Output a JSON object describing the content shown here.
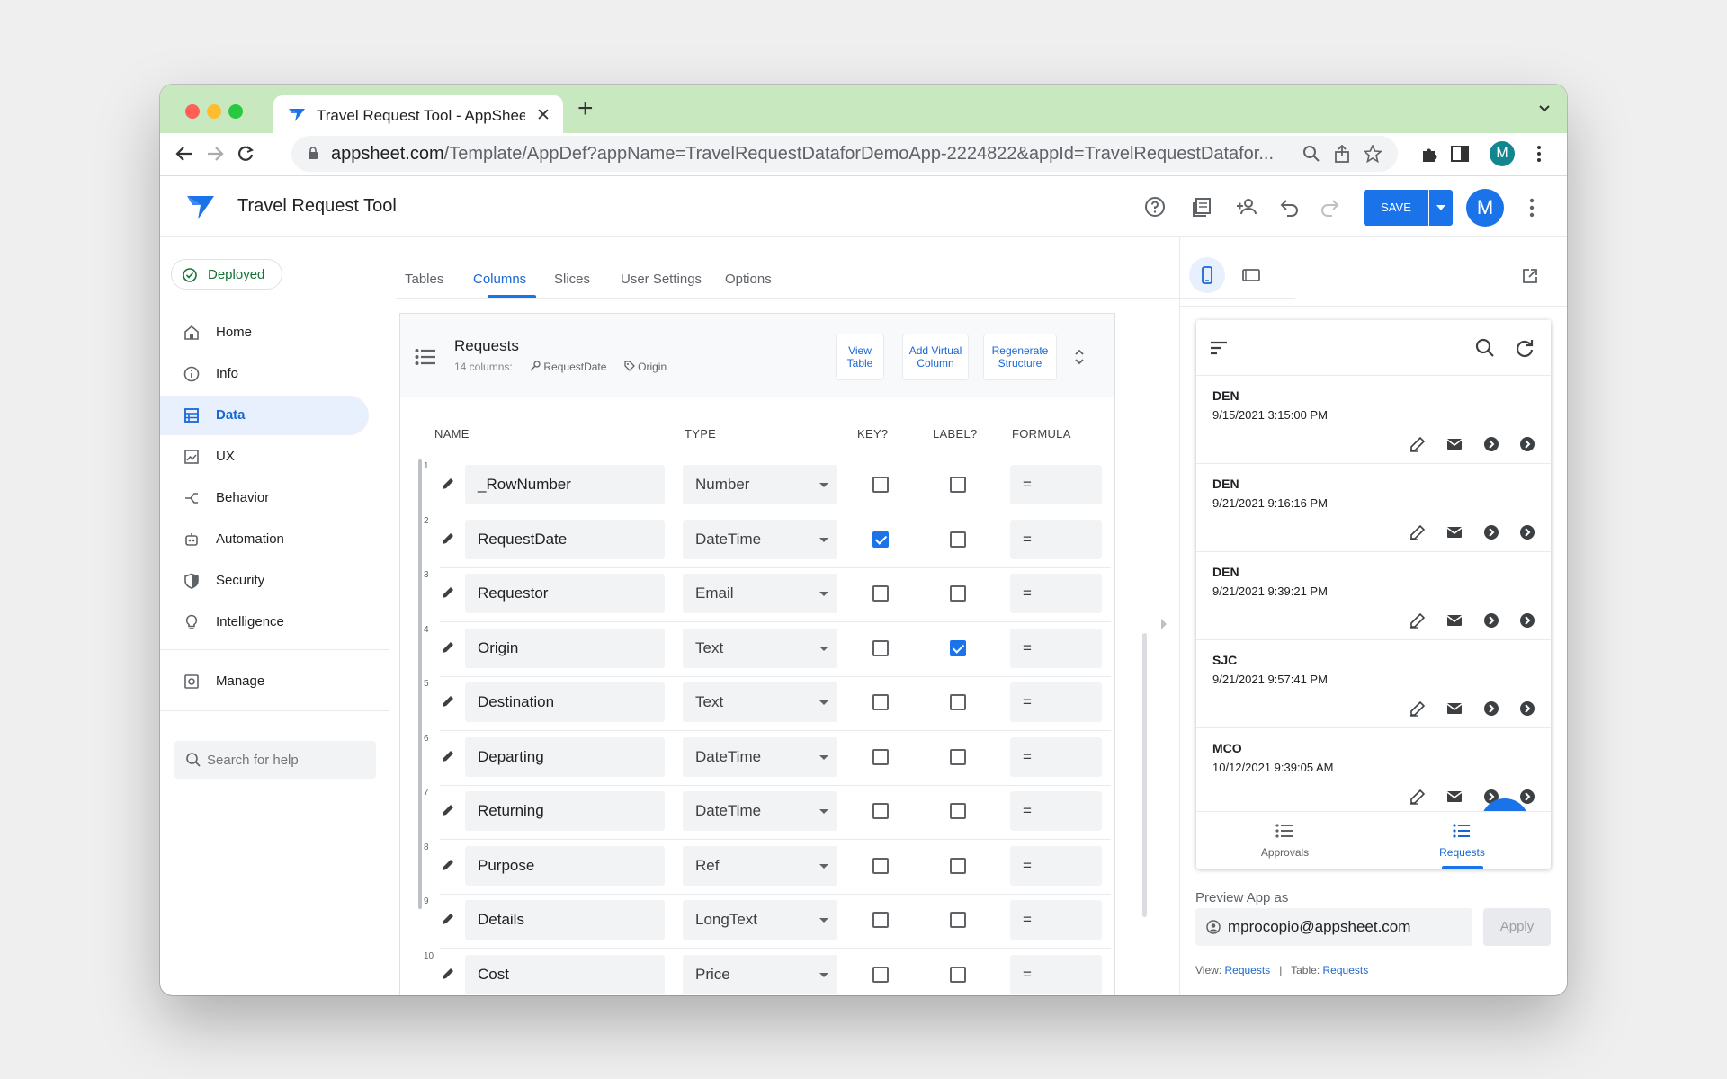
{
  "browser": {
    "tab_title": "Travel Request Tool - AppSheet",
    "url_host": "appsheet.com",
    "url_path": "/Template/AppDef?appName=TravelRequestDataforDemoApp-2224822&appId=TravelRequestDatafor...",
    "profile_initial": "M"
  },
  "app": {
    "title": "Travel Request Tool",
    "save_label": "SAVE",
    "avatar_initial": "M",
    "status": "Deployed"
  },
  "sidebar": {
    "items": [
      {
        "label": "Home",
        "icon": "home-icon"
      },
      {
        "label": "Info",
        "icon": "info-icon"
      },
      {
        "label": "Data",
        "icon": "data-icon",
        "active": true
      },
      {
        "label": "UX",
        "icon": "ux-icon"
      },
      {
        "label": "Behavior",
        "icon": "behavior-icon"
      },
      {
        "label": "Automation",
        "icon": "automation-icon"
      },
      {
        "label": "Security",
        "icon": "shield-icon"
      },
      {
        "label": "Intelligence",
        "icon": "lightbulb-icon"
      },
      {
        "label": "Manage",
        "icon": "manage-icon"
      }
    ],
    "search_placeholder": "Search for help"
  },
  "tabs": [
    "Tables",
    "Columns",
    "Slices",
    "User Settings",
    "Options"
  ],
  "active_tab": "Columns",
  "table": {
    "name": "Requests",
    "columns_count": "14 columns:",
    "key_column": "RequestDate",
    "label_column": "Origin",
    "buttons": {
      "view_table": "View Table",
      "add_virtual": "Add Virtual Column",
      "regenerate": "Regenerate Structure"
    },
    "headers": {
      "name": "NAME",
      "type": "TYPE",
      "key": "KEY?",
      "label": "LABEL?",
      "formula": "FORMULA"
    },
    "rows": [
      {
        "num": "1",
        "name": "_RowNumber",
        "type": "Number",
        "key": false,
        "label": false,
        "formula": "="
      },
      {
        "num": "2",
        "name": "RequestDate",
        "type": "DateTime",
        "key": true,
        "label": false,
        "formula": "="
      },
      {
        "num": "3",
        "name": "Requestor",
        "type": "Email",
        "key": false,
        "label": false,
        "formula": "="
      },
      {
        "num": "4",
        "name": "Origin",
        "type": "Text",
        "key": false,
        "label": true,
        "formula": "="
      },
      {
        "num": "5",
        "name": "Destination",
        "type": "Text",
        "key": false,
        "label": false,
        "formula": "="
      },
      {
        "num": "6",
        "name": "Departing",
        "type": "DateTime",
        "key": false,
        "label": false,
        "formula": "="
      },
      {
        "num": "7",
        "name": "Returning",
        "type": "DateTime",
        "key": false,
        "label": false,
        "formula": "="
      },
      {
        "num": "8",
        "name": "Purpose",
        "type": "Ref",
        "key": false,
        "label": false,
        "formula": "="
      },
      {
        "num": "9",
        "name": "Details",
        "type": "LongText",
        "key": false,
        "label": false,
        "formula": "="
      },
      {
        "num": "10",
        "name": "Cost",
        "type": "Price",
        "key": false,
        "label": false,
        "formula": "="
      }
    ]
  },
  "preview": {
    "records": [
      {
        "code": "DEN",
        "date": "9/15/2021 3:15:00 PM"
      },
      {
        "code": "DEN",
        "date": "9/21/2021 9:16:16 PM"
      },
      {
        "code": "DEN",
        "date": "9/21/2021 9:39:21 PM"
      },
      {
        "code": "SJC",
        "date": "9/21/2021 9:57:41 PM"
      },
      {
        "code": "MCO",
        "date": "10/12/2021 9:39:05 AM"
      }
    ],
    "nav": [
      {
        "label": "Approvals"
      },
      {
        "label": "Requests",
        "active": true
      }
    ],
    "preview_as_label": "Preview App as",
    "preview_email": "mprocopio@appsheet.com",
    "apply_label": "Apply",
    "footer": {
      "view_label": "View:",
      "view_value": "Requests",
      "separator": "|",
      "table_label": "Table:",
      "table_value": "Requests"
    }
  },
  "colors": {
    "tabstrip": "#c8e9bf",
    "accent": "#1a73e8",
    "deployed": "#137333"
  }
}
